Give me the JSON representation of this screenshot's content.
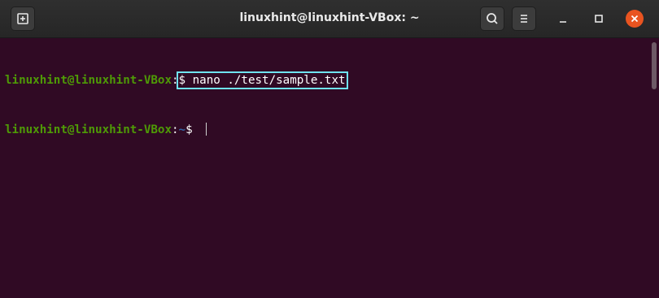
{
  "window": {
    "title": "linuxhint@linuxhint-VBox: ~"
  },
  "colors": {
    "terminal_bg": "#300a24",
    "prompt_user": "#4e9a06",
    "prompt_path": "#3465a4",
    "highlight_box": "#6fe3f0",
    "close_button": "#e95420"
  },
  "icons": {
    "new_tab": "new-tab-icon",
    "search": "search-icon",
    "menu": "hamburger-menu-icon",
    "minimize": "minimize-icon",
    "maximize": "maximize-icon",
    "close": "close-icon"
  },
  "terminal": {
    "lines": [
      {
        "user_host": "linuxhint@linuxhint-VBox",
        "colon": ":",
        "path": "",
        "command": "$ nano ./test/sample.txt"
      },
      {
        "user_host": "linuxhint@linuxhint-VBox",
        "colon": ":",
        "path": "~",
        "command": "$ "
      }
    ]
  }
}
